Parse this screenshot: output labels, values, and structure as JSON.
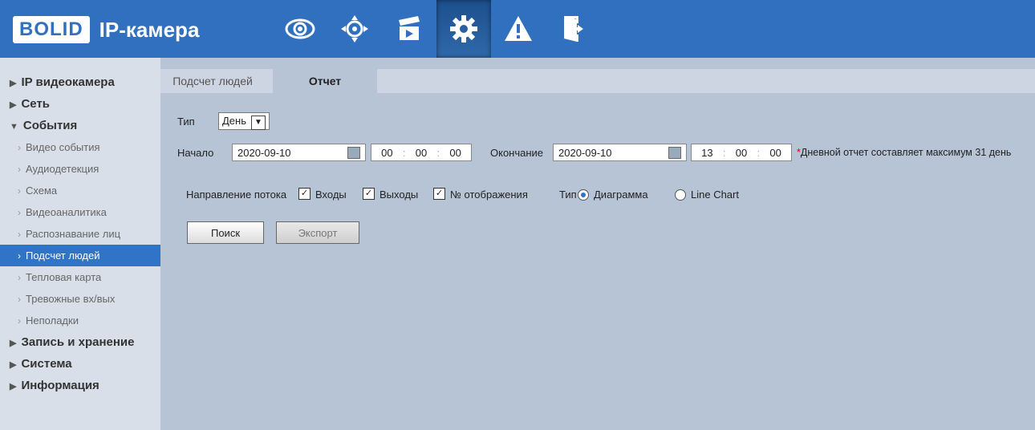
{
  "header": {
    "logo_brand": "BOLID",
    "logo_text": "IP-камера",
    "nav_icons": [
      "eye-icon",
      "ptz-icon",
      "clapper-icon",
      "gear-icon",
      "warning-icon",
      "exit-icon"
    ],
    "active_nav": "gear-icon"
  },
  "sidebar": {
    "groups": [
      {
        "label": "IP видеокамера"
      },
      {
        "label": "Сеть"
      },
      {
        "label": "События"
      }
    ],
    "event_items": [
      {
        "label": "Видео события"
      },
      {
        "label": "Аудиодетекция"
      },
      {
        "label": "Схема"
      },
      {
        "label": "Видеоаналитика"
      },
      {
        "label": "Распознавание лиц"
      },
      {
        "label": "Подсчет людей"
      },
      {
        "label": "Тепловая карта"
      },
      {
        "label": "Тревожные вх/вых"
      },
      {
        "label": "Неполадки"
      }
    ],
    "bottom_groups": [
      {
        "label": "Запись и хранение"
      },
      {
        "label": "Система"
      },
      {
        "label": "Информация"
      }
    ]
  },
  "tabs": [
    {
      "label": "Подсчет людей"
    },
    {
      "label": "Отчет"
    }
  ],
  "form": {
    "type_label": "Тип",
    "type_value": "День",
    "start_label": "Начало",
    "start_date": "2020-09-10",
    "start_h": "00",
    "start_m": "00",
    "start_s": "00",
    "end_label": "Окончание",
    "end_date": "2020-09-10",
    "end_h": "13",
    "end_m": "00",
    "end_s": "00",
    "note_star": "*",
    "note": "Дневной отчет составляет максимум 31 день",
    "flow_label": "Направление потока",
    "cb_in": "Входы",
    "cb_out": "Выходы",
    "cb_display": "№ отображения",
    "chart_type_label": "Тип",
    "radio_bar": "Диаграмма",
    "radio_line": "Line Chart",
    "search_btn": "Поиск",
    "export_btn": "Экспорт"
  },
  "colors": {
    "header": "#3070be",
    "active": "#2f74c6",
    "content": "#b7c4d6"
  }
}
